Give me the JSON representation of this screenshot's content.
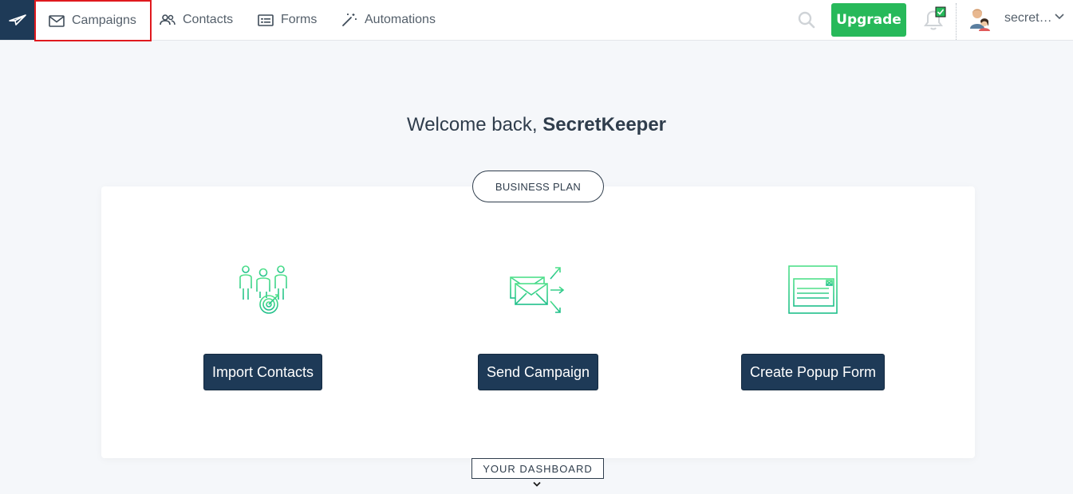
{
  "nav": {
    "items": [
      {
        "label": "Campaigns",
        "icon": "envelope-icon"
      },
      {
        "label": "Contacts",
        "icon": "contacts-icon"
      },
      {
        "label": "Forms",
        "icon": "form-icon"
      },
      {
        "label": "Automations",
        "icon": "magic-wand-icon"
      }
    ],
    "upgrade_label": "Upgrade",
    "user_name": "secretkeeper"
  },
  "welcome": {
    "prefix": "Welcome back, ",
    "name": "SecretKeeper"
  },
  "plan_badge": "BUSINESS PLAN",
  "actions": [
    {
      "label": "Import Contacts",
      "icon": "target-audience-icon"
    },
    {
      "label": "Send Campaign",
      "icon": "send-mail-icon"
    },
    {
      "label": "Create Popup Form",
      "icon": "popup-form-icon"
    }
  ],
  "dashboard_tab": "YOUR DASHBOARD",
  "colors": {
    "brand_navy": "#1e3a57",
    "upgrade_green": "#27b95a",
    "highlight_red": "#e0191e",
    "icon_green": "#3ddc84"
  }
}
